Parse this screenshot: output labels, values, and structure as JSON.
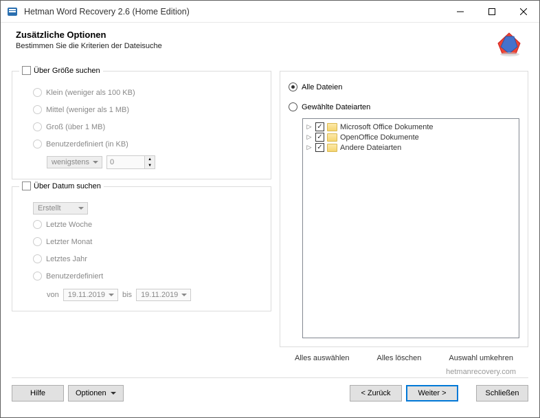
{
  "window": {
    "title": "Hetman Word Recovery 2.6 (Home Edition)"
  },
  "header": {
    "title": "Zusätzliche Optionen",
    "subtitle": "Bestimmen Sie die Kriterien der Dateisuche"
  },
  "size_group": {
    "label": "Über Größe suchen",
    "options": {
      "small": "Klein (weniger als 100 KB)",
      "medium": "Mittel (weniger als 1 MB)",
      "large": "Groß (über 1 MB)",
      "custom": "Benutzerdefiniert (in KB)"
    },
    "custom_qualifier": "wenigstens",
    "custom_value": "0"
  },
  "date_group": {
    "label": "Über Datum suchen",
    "mode": "Erstellt",
    "options": {
      "week": "Letzte Woche",
      "month": "Letzter Monat",
      "year": "Letztes Jahr",
      "custom": "Benutzerdefiniert"
    },
    "from_label": "von",
    "to_label": "bis",
    "from_date": "19.11.2019",
    "to_date": "19.11.2019"
  },
  "filetype": {
    "all": "Alle Dateien",
    "selected": "Gewählte Dateiarten",
    "tree": [
      {
        "label": "Microsoft Office Dokumente"
      },
      {
        "label": "OpenOffice Dokumente"
      },
      {
        "label": "Andere Dateiarten"
      }
    ],
    "actions": {
      "select_all": "Alles auswählen",
      "clear_all": "Alles löschen",
      "invert": "Auswahl umkehren"
    }
  },
  "footer": {
    "link": "hetmanrecovery.com",
    "help": "Hilfe",
    "options": "Optionen",
    "back": "< Zurück",
    "next": "Weiter >",
    "close": "Schließen"
  }
}
